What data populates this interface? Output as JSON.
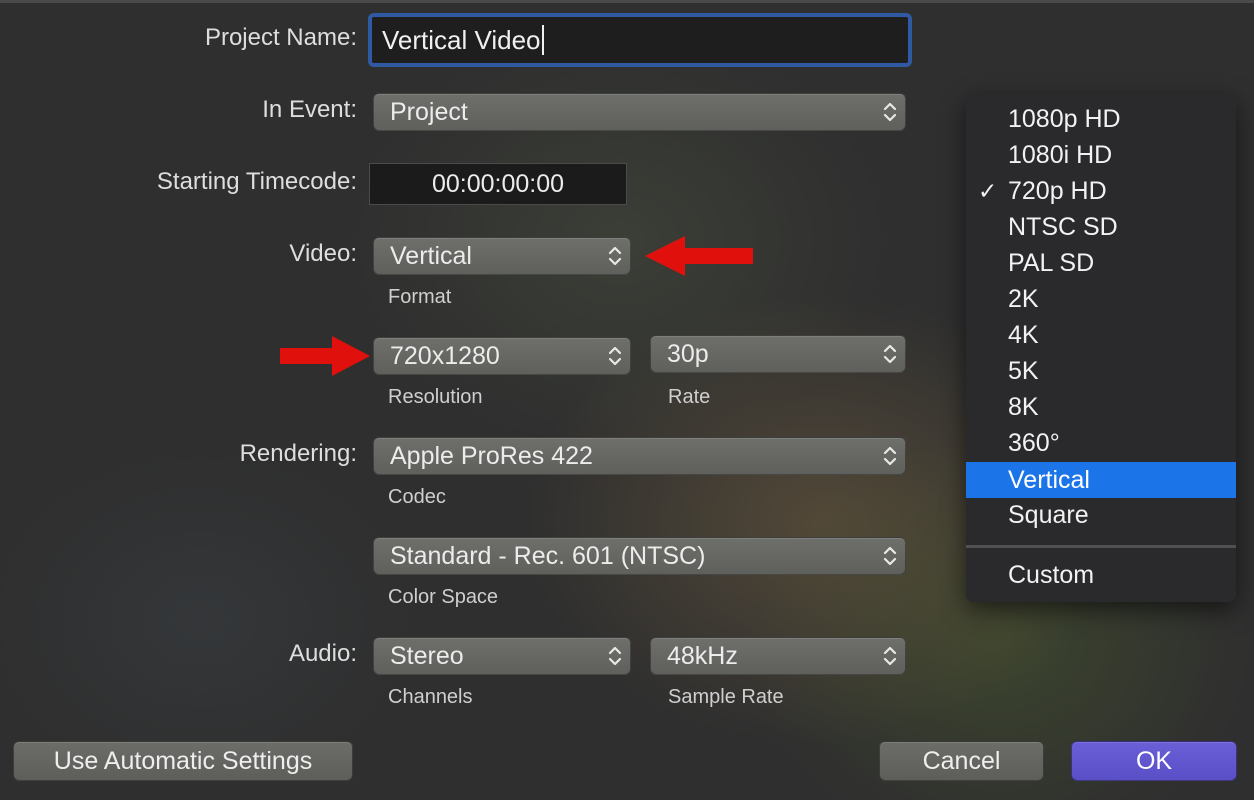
{
  "project_name": {
    "label": "Project Name:",
    "value": "Vertical Video"
  },
  "in_event": {
    "label": "In Event:",
    "value": "Project"
  },
  "starting_timecode": {
    "label": "Starting Timecode:",
    "value": "00:00:00:00"
  },
  "video": {
    "label": "Video:",
    "format_value": "Vertical",
    "format_label": "Format",
    "resolution_value": "720x1280",
    "resolution_label": "Resolution",
    "rate_value": "30p",
    "rate_label": "Rate"
  },
  "rendering": {
    "label": "Rendering:",
    "codec_value": "Apple ProRes 422",
    "codec_label": "Codec",
    "color_space_value": "Standard - Rec. 601 (NTSC)",
    "color_space_label": "Color Space"
  },
  "audio": {
    "label": "Audio:",
    "channels_value": "Stereo",
    "channels_label": "Channels",
    "sample_rate_value": "48kHz",
    "sample_rate_label": "Sample Rate"
  },
  "buttons": {
    "automatic": "Use Automatic Settings",
    "cancel": "Cancel",
    "ok": "OK"
  },
  "format_menu": {
    "items": [
      "1080p HD",
      "1080i HD",
      "720p HD",
      "NTSC SD",
      "PAL SD",
      "2K",
      "4K",
      "5K",
      "8K",
      "360°",
      "Vertical",
      "Square"
    ],
    "checked": "720p HD",
    "highlighted": "Vertical",
    "check_mark": "✓",
    "custom": "Custom"
  },
  "colors": {
    "highlight": "#1b74e8",
    "ok_button": "#5a4fc6",
    "focus_ring": "#2f5aa1",
    "annotation_arrow": "#e0100d"
  },
  "icons": {
    "popup_chevron": "chevron-up-down-icon",
    "annotation": "red-arrow-icon"
  }
}
